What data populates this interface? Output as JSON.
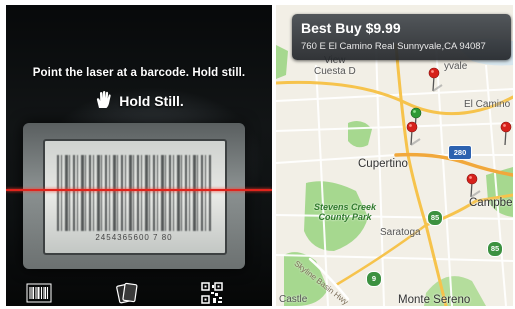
{
  "scanner": {
    "prompt": "Point the laser at a barcode. Hold still.",
    "status": "Hold Still.",
    "barcode_digits": "2454365600 7 80",
    "laser_color": "#e0241c",
    "toolbar": [
      {
        "icon": "barcode-icon"
      },
      {
        "icon": "cards-icon"
      },
      {
        "icon": "qr-code-icon"
      }
    ]
  },
  "map": {
    "callout": {
      "store_price": "Best Buy $9.99",
      "address": "760 E El Camino Real Sunnyvale,CA 94087"
    },
    "places": {
      "cuesta": "Cuesta D",
      "view": "View",
      "sunnyvale": "yvale",
      "el_camino": "El Camino I",
      "cupertino": "Cupertino",
      "campbell": "Campbe",
      "saratoga": "Saratoga",
      "castle": "Castle",
      "monte_sereno": "Monte Sereno",
      "park": "Stevens Creek\nCounty Park",
      "road": "Skyline Basin Hwy"
    },
    "shields": {
      "i280": "280",
      "r85_a": "85",
      "r85_b": "85",
      "r9": "9"
    },
    "colors": {
      "pin_red": "#d6211b",
      "pin_green": "#2e9a35",
      "park_green": "#a6d88f",
      "highway": "#f6c34c"
    }
  }
}
